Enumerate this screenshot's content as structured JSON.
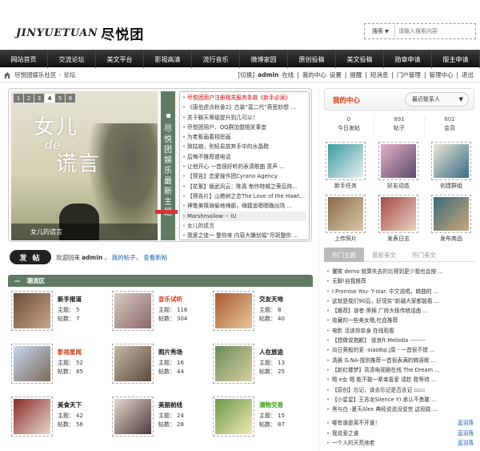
{
  "header": {
    "logo_latin": "JINYUETUAN",
    "logo_cn": "尽悦团",
    "search_type": "搜索",
    "search_placeholder": "请输入搜索内容"
  },
  "nav": [
    "网站首页",
    "交流论坛",
    "美文平台",
    "影视高清",
    "流行音乐",
    "微博家园",
    "原创投稿",
    "美文投稿",
    "勋章申请",
    "版主申请"
  ],
  "breadcrumb": {
    "site": "尽悦团娱乐社区",
    "sep": "›",
    "current": "论坛"
  },
  "userbar": {
    "switch": "[切换]",
    "username": "admin",
    "status": "在线",
    "links": [
      "我的中心",
      "设置",
      "提醒",
      "短消息",
      "门户管理",
      "管理中心",
      "退出"
    ]
  },
  "slider": {
    "tabs": [
      "1",
      "2",
      "3",
      "4",
      "5",
      "6"
    ],
    "active_tab": "4",
    "image_text": {
      "line1": "女儿",
      "line2": "de",
      "line3": "谎言"
    },
    "caption": "女儿的谎言",
    "vertical_title": [
      "尽",
      "悦",
      "团",
      "娱",
      "乐",
      "最",
      "新",
      "主",
      "题"
    ],
    "list": [
      {
        "text": "尽悦团用户注册相关服务条款《新手必读》",
        "style": "red"
      },
      {
        "text": "《唐伯虎点秋香2》古装“富二代”奇思妙想 ...",
        "style": ""
      },
      {
        "text": "关于聊天等级提升到几可以！",
        "style": ""
      },
      {
        "text": "尽悦团用户、QQ群加盟相关事宜",
        "style": ""
      },
      {
        "text": "为老板画着相思画",
        "style": ""
      },
      {
        "text": "致姑娘，别轻易放弃手中的水晶鞋",
        "style": ""
      },
      {
        "text": "后悔不推荐遗电话",
        "style": ""
      },
      {
        "text": "让他开心 一首很好听的表清歌曲 意声 ...",
        "style": ""
      },
      {
        "text": "【预告】恋爱操作团Cyrano Agency",
        "style": ""
      },
      {
        "text": "【花絮】循武风云：陈真 制作特辑之荣后阵...",
        "style": ""
      },
      {
        "text": "【预告片】山楂树之恋The Love of the Hawt...",
        "style": ""
      },
      {
        "text": "神笔美筷骑偷地嗨部，嗨捷遥嗯嗯晚出场 ...",
        "style": ""
      },
      {
        "text": "Marshmallow -- IU",
        "style": "hl"
      },
      {
        "text": "女儿的谎言",
        "style": ""
      },
      {
        "text": "我爱之徒一 整你来 内容大嫌划幅“尽斑整你 ...",
        "style": ""
      }
    ]
  },
  "postbar": {
    "button": "发 帖",
    "welcome": "欢迎回来",
    "username": "admin",
    "comma": "，",
    "my_posts": "我的帖子，",
    "view_new": "查看新帖"
  },
  "forum_section": {
    "title": "潮流区",
    "topic_label": "主题：",
    "post_label": "帖数：",
    "forums": [
      {
        "name": "新手报道",
        "topics": "5",
        "posts": "7",
        "color": "",
        "img": [
          "#6b4a3a",
          "#c9a68a"
        ]
      },
      {
        "name": "音乐试听",
        "topics": "116",
        "posts": "304",
        "color": "red",
        "img": [
          "#d8c8c0",
          "#8a6a6a"
        ]
      },
      {
        "name": "交友天地",
        "topics": "8",
        "posts": "40",
        "color": "",
        "img": [
          "#a85a2a",
          "#e8c8a0"
        ]
      },
      {
        "name": "影视星闻",
        "topics": "52",
        "posts": "85",
        "color": "red",
        "img": [
          "#c8d8f0",
          "#7a6a5a"
        ]
      },
      {
        "name": "照片秀场",
        "topics": "16",
        "posts": "44",
        "color": "",
        "img": [
          "#c8b8a8",
          "#5a4a3a"
        ]
      },
      {
        "name": "人在旅途",
        "topics": "13",
        "posts": "25",
        "color": "",
        "img": [
          "#6a8a5a",
          "#d8d0a0"
        ]
      },
      {
        "name": "美食天下",
        "topics": "42",
        "posts": "56",
        "color": "",
        "img": [
          "#8a2a2a",
          "#e8d8c8"
        ]
      },
      {
        "name": "美丽前线",
        "topics": "24",
        "posts": "28",
        "color": "",
        "img": [
          "#e8d8d0",
          "#4a3a3a"
        ]
      },
      {
        "name": "潮物交易",
        "topics": "15",
        "posts": "87",
        "color": "green",
        "img": [
          "#6a9a4a",
          "#f0e8b0"
        ]
      }
    ]
  },
  "my_center": {
    "title": "我的中心",
    "recent": "最近联系人",
    "stats": [
      {
        "value": "0",
        "label": "今日发帖"
      },
      {
        "value": "891",
        "label": "帖子"
      },
      {
        "value": "601",
        "label": "会员"
      }
    ],
    "apps": [
      {
        "label": "新手任务",
        "img": [
          "#3a9aa0",
          "#e8f0f0"
        ]
      },
      {
        "label": "好友动态",
        "img": [
          "#e8b0c8",
          "#5a4a6a"
        ]
      },
      {
        "label": "创建群组",
        "img": [
          "#e8e8d0",
          "#3a6a8a"
        ]
      },
      {
        "label": "上传照片",
        "img": [
          "#8a6a4a",
          "#d8c8a8"
        ]
      },
      {
        "label": "发表日志",
        "img": [
          "#a84a4a",
          "#e8d0c0"
        ]
      },
      {
        "label": "发布商品",
        "img": [
          "#3a6a7a",
          "#c8a878"
        ]
      }
    ]
  },
  "hot": {
    "tabs": [
      "热门主题",
      "最新美文",
      "热门美文"
    ],
    "active": "热门主题",
    "list": [
      {
        "text": "儷笑 demo 就算失去的比得到更少我也会按 ...",
        "author": ""
      },
      {
        "text": "无聊!自我推荐",
        "author": ""
      },
      {
        "text": "I Promise You- Y-star. 中文说唱，韩曲的 ...",
        "author": ""
      },
      {
        "text": "这就是我们90后，好现实“新疆大家都能看 ...",
        "author": ""
      },
      {
        "text": "【推荐】谜者-黑棉 广府大极传统话曲 ...",
        "author": ""
      },
      {
        "text": "收藏的一些美女哦,吐血推荐",
        "author": ""
      },
      {
        "text": "电影 活该你单身 在线观看",
        "author": ""
      },
      {
        "text": "【想做说抱歉】 徐良ft.Melodia --------",
        "author": ""
      },
      {
        "text": "向日葵般的爱 -xiao8qi.J周 - 一首很不错 ...",
        "author": ""
      },
      {
        "text": "清晨 G.NA-搜到推荐一首很表满的韩语歌 ...",
        "author": ""
      },
      {
        "text": "【新红楼梦】高清电视剧在线 The Dream ...",
        "author": ""
      },
      {
        "text": "嗯 e女 嗯 乾不敢一辈幸喜爱 请趁 我等待 ...",
        "author": ""
      },
      {
        "text": "【原创】忘记，该去忘记是否去记 ▫▫▫",
        "author": ""
      },
      {
        "text": "【小星星】王苏龙Silence Y) 承认不勇敢 ...",
        "author": ""
      },
      {
        "text": "黑与白 -夏天Alex 典经说说没说完 这段路 ...",
        "author": ""
      },
      {
        "text": "哪有谁是离不开谁！",
        "author": "蓝羽落"
      },
      {
        "text": "我说爱之谁",
        "author": "蓝羽落"
      },
      {
        "text": "一个人的天荒地老",
        "author": "蓝羽落"
      }
    ]
  }
}
